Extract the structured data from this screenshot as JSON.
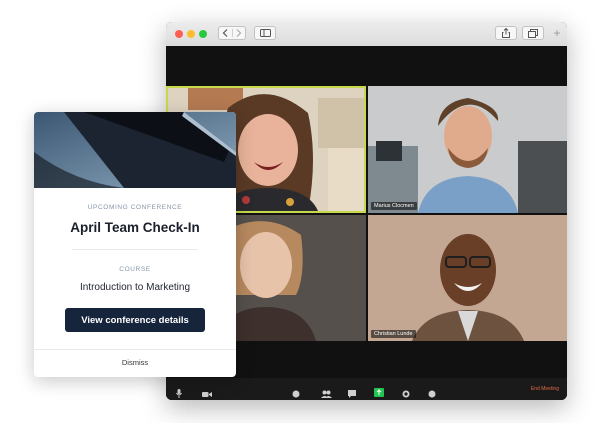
{
  "conference": {
    "eyebrow": "UPCOMING CONFERENCE",
    "title": "April Team Check-In",
    "course_eyebrow": "COURSE",
    "course_name": "Introduction to Marketing",
    "cta_label": "View conference details",
    "dismiss_label": "Dismiss"
  },
  "video_call": {
    "participants": [
      {
        "name": "",
        "active_speaker": true
      },
      {
        "name": "Marius Clocmen",
        "active_speaker": false
      },
      {
        "name": "",
        "active_speaker": false
      },
      {
        "name": "Christian Lunde",
        "active_speaker": false
      }
    ],
    "end_meeting_label": "End Meeting",
    "active_speaker_color": "#c7d94a",
    "end_color": "#e06a42"
  },
  "browser": {
    "toolbar_icons": [
      "back-icon",
      "forward-icon",
      "sidebar-icon",
      "share-icon",
      "tabs-icon",
      "new-tab-icon"
    ]
  }
}
